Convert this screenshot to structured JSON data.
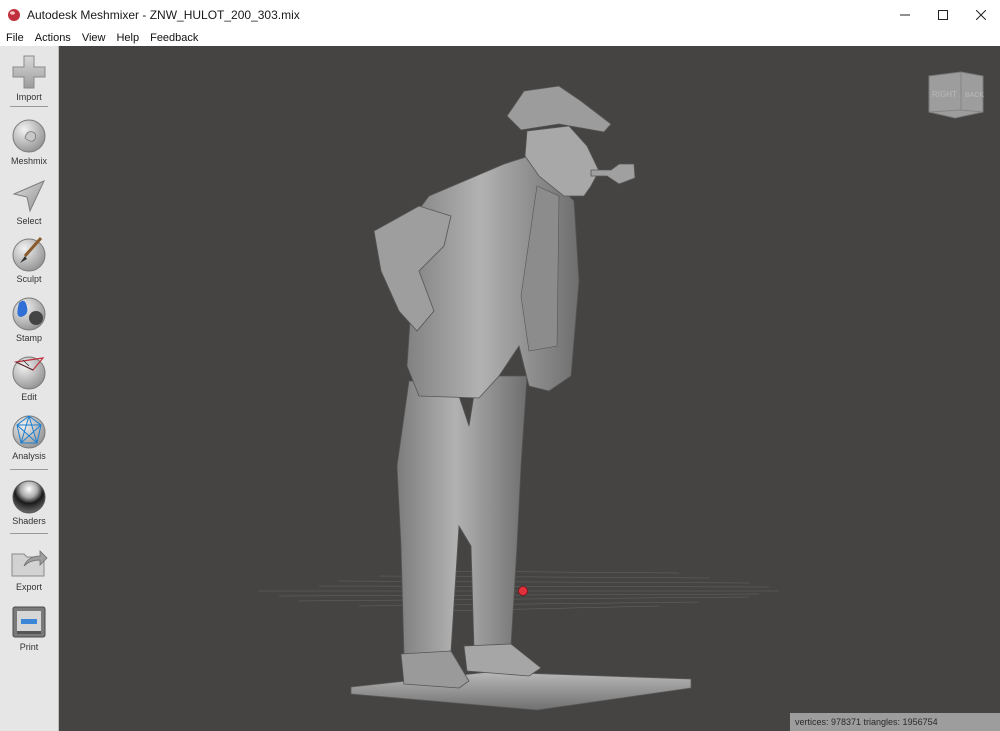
{
  "window": {
    "title": "Autodesk Meshmixer - ZNW_HULOT_200_303.mix",
    "controls": {
      "minimize": "minimize-icon",
      "maximize": "maximize-icon",
      "close": "close-icon"
    }
  },
  "menu": [
    "File",
    "Actions",
    "View",
    "Help",
    "Feedback"
  ],
  "toolbar": {
    "tools": [
      {
        "label": "Import",
        "icon": "plus-icon"
      },
      {
        "label": "Meshmix",
        "icon": "bunny-sphere-icon"
      },
      {
        "label": "Select",
        "icon": "arrow-cursor-icon"
      },
      {
        "label": "Sculpt",
        "icon": "brush-sphere-icon"
      },
      {
        "label": "Stamp",
        "icon": "stamp-icon"
      },
      {
        "label": "Edit",
        "icon": "edit-sphere-icon"
      },
      {
        "label": "Analysis",
        "icon": "wireframe-sphere-icon"
      },
      {
        "label": "Shaders",
        "icon": "chrome-sphere-icon"
      },
      {
        "label": "Export",
        "icon": "export-folder-icon"
      },
      {
        "label": "Print",
        "icon": "printer-icon"
      }
    ]
  },
  "viewcube": {
    "faces": [
      "RIGHT",
      "BACK"
    ]
  },
  "status": {
    "text": "vertices: 978371 triangles: 1956754"
  },
  "colors": {
    "viewport_bg": "#454443",
    "model": "#9a9a9a",
    "pivot": "#e0303a"
  }
}
